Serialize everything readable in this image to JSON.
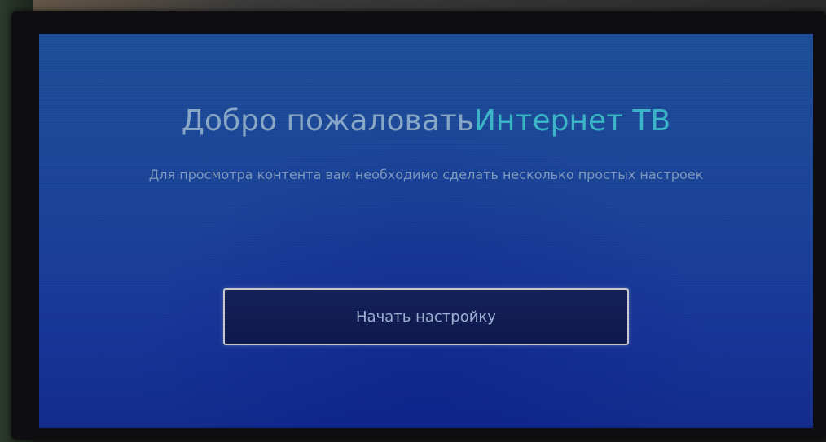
{
  "welcome": {
    "title_part1": "Добро пожаловать",
    "title_part2": "Интернет ТВ",
    "subtitle": "Для просмотра контента вам необходимо сделать несколько простых настроек",
    "start_button_label": "Начать настройку"
  },
  "colors": {
    "screen_background": "#1c449a",
    "title_primary": "#8aa9c9",
    "title_accent": "#3bb7c9",
    "button_background": "#14215a",
    "button_border": "#c9ccd6"
  }
}
